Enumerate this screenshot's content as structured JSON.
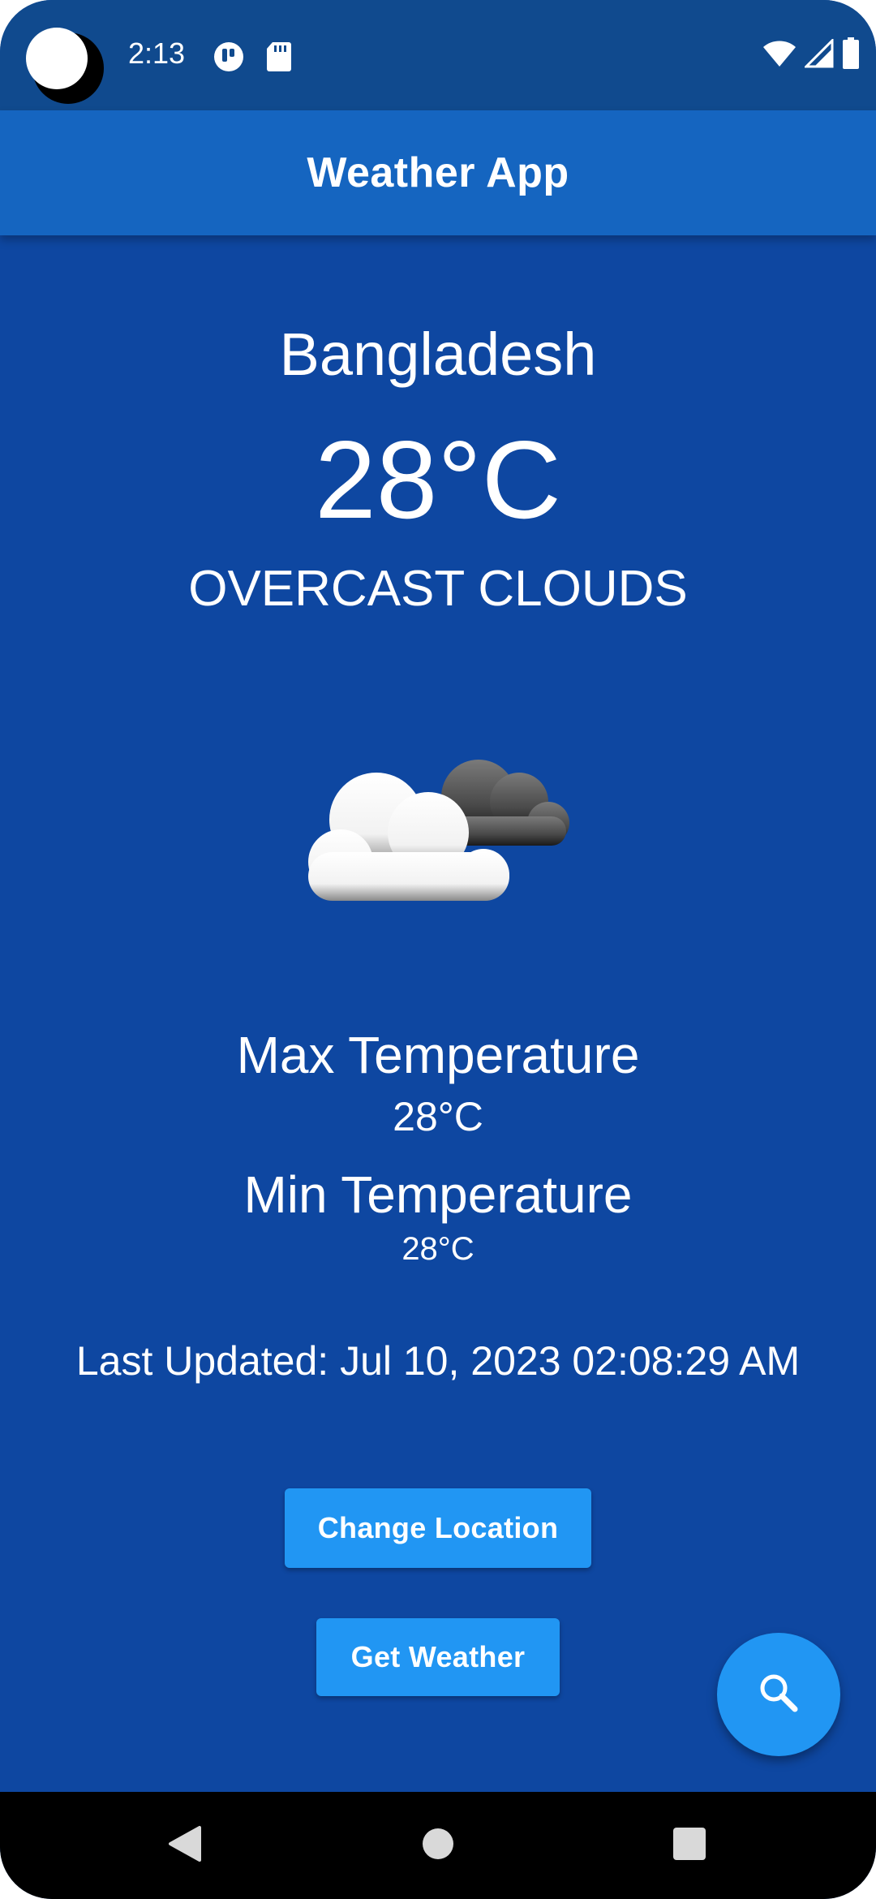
{
  "status_bar": {
    "time": "2:13",
    "icons": [
      "notification-app-icon",
      "sd-card-icon",
      "wifi-icon",
      "signal-icon",
      "battery-icon"
    ]
  },
  "app_bar": {
    "title": "Weather App"
  },
  "weather": {
    "location": "Bangladesh",
    "temperature": "28°C",
    "condition": "OVERCAST CLOUDS",
    "icon": "overcast-clouds-icon",
    "max_label": "Max Temperature",
    "max_value": "28°C",
    "min_label": "Min Temperature",
    "min_value": "28°C",
    "last_updated": "Last Updated: Jul 10, 2023 02:08:29 AM"
  },
  "actions": {
    "change_location": "Change Location",
    "get_weather": "Get Weather",
    "fab_icon": "search-icon"
  },
  "nav_bar": {
    "icons": [
      "back-icon",
      "home-icon",
      "recents-icon"
    ]
  },
  "colors": {
    "background": "#0e47a1",
    "status_bar": "#104a8e",
    "app_bar": "#1565c0",
    "button": "#2196f3",
    "text": "#ffffff"
  }
}
